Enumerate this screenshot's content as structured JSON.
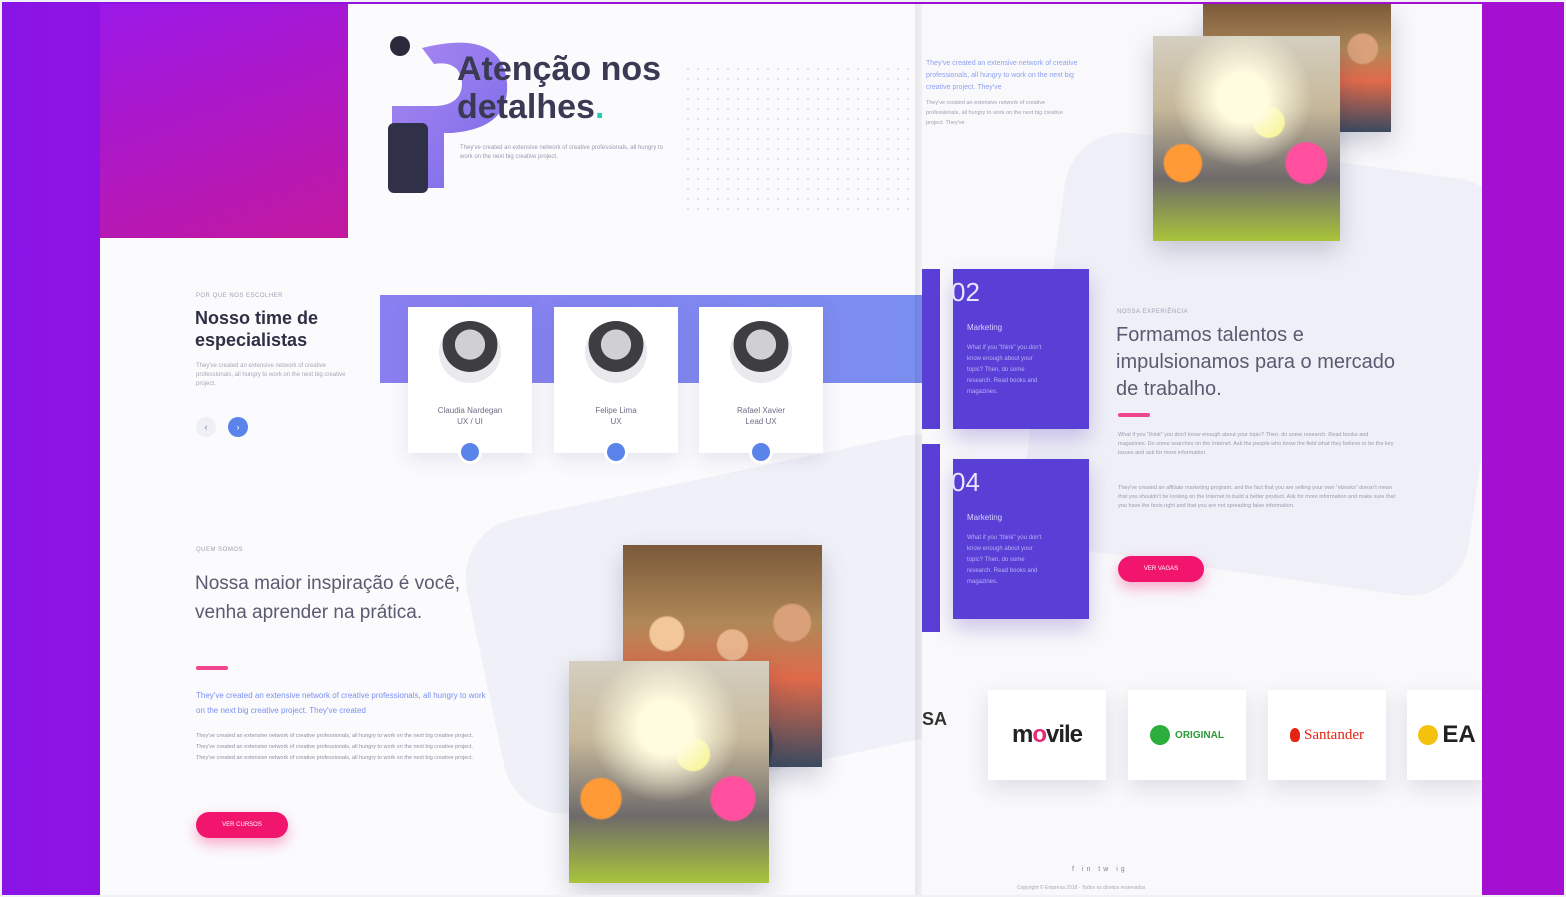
{
  "left": {
    "hero": {
      "title_line1": "Atenção nos",
      "title_line2": "detalhes",
      "title_dot": ".",
      "description": "They've created an extensive network of creative professionals, all hungry to work on the next big creative project."
    },
    "team": {
      "label": "POR QUE NOS ESCOLHER",
      "title": "Nosso time de especialistas",
      "description": "They've created an extensive network of creative professionals, all hungry to work on the next big creative project.",
      "nav_prev": "‹",
      "nav_next": "›",
      "members": [
        {
          "name": "Claudia Nardegan",
          "role": "UX / UI"
        },
        {
          "name": "Felipe Lima",
          "role": "UX"
        },
        {
          "name": "Rafael Xavier",
          "role": "Lead UX"
        }
      ]
    },
    "inspiration": {
      "label": "QUEM SOMOS",
      "title": "Nossa maior inspiração é você, venha aprender na prática.",
      "link_text": "They've created an extensive network of creative professionals, all hungry to work on the next big creative project. They've created",
      "body": "They've created an extensive network of creative professionals, all hungry to work on the next big creative project. They've created an extensive network of creative professionals, all hungry to work on the next big creative project. They've created an extensive network of creative professionals, all hungry to work on the next big creative project.",
      "button_label": "VER CURSOS"
    }
  },
  "right": {
    "top_text": "They've created an extensive network of creative professionals, all hungry to work on the next big creative project. They've",
    "top_text2": "They've created an extensive network of creative professionals, all hungry to work on the next big creative project. They've",
    "steps": [
      {
        "number": "02",
        "title": "Marketing",
        "body": "What if you \"think\" you don't know enough about your topic? Then, do some research. Read books and magazines."
      },
      {
        "number": "04",
        "title": "Marketing",
        "body": "What if you \"think\" you don't know enough about your topic? Then, do some research. Read books and magazines."
      }
    ],
    "section": {
      "label": "NOSSA EXPERIÊNCIA",
      "title": "Formamos talentos e impulsionamos para o mercado de trabalho.",
      "body1": "What if you \"think\" you don't know enough about your topic? Then, do some research. Read books and magazines. Do some searches on the Internet. Ask the people who know the field what they believe to be the key issues and ask for more information.",
      "body2": "They've created an affiliate marketing program, and the fact that you are selling your own \"ebooks\" doesn't mean that you shouldn't be looking on the Internet to build a better product. Ask for more information and make sure that you have the facts right and that you are not spreading false information.",
      "button_label": "VER VAGAS"
    },
    "partners": {
      "partial": "SA",
      "logos": [
        "movile",
        "ORIGINAL",
        "Santander",
        "EA"
      ]
    },
    "footer": {
      "social": "f in tw ig",
      "copyright": "Copyright © Empresa 2018 - Todos os direitos reservados"
    }
  },
  "colors": {
    "background": "#9b12dd",
    "hero_gradient": "#b8179f",
    "accent_blue": "#5b84ea",
    "accent_pink": "#f2156e",
    "step_purple": "#5a3fd6",
    "teal_dot": "#27c9b8"
  }
}
